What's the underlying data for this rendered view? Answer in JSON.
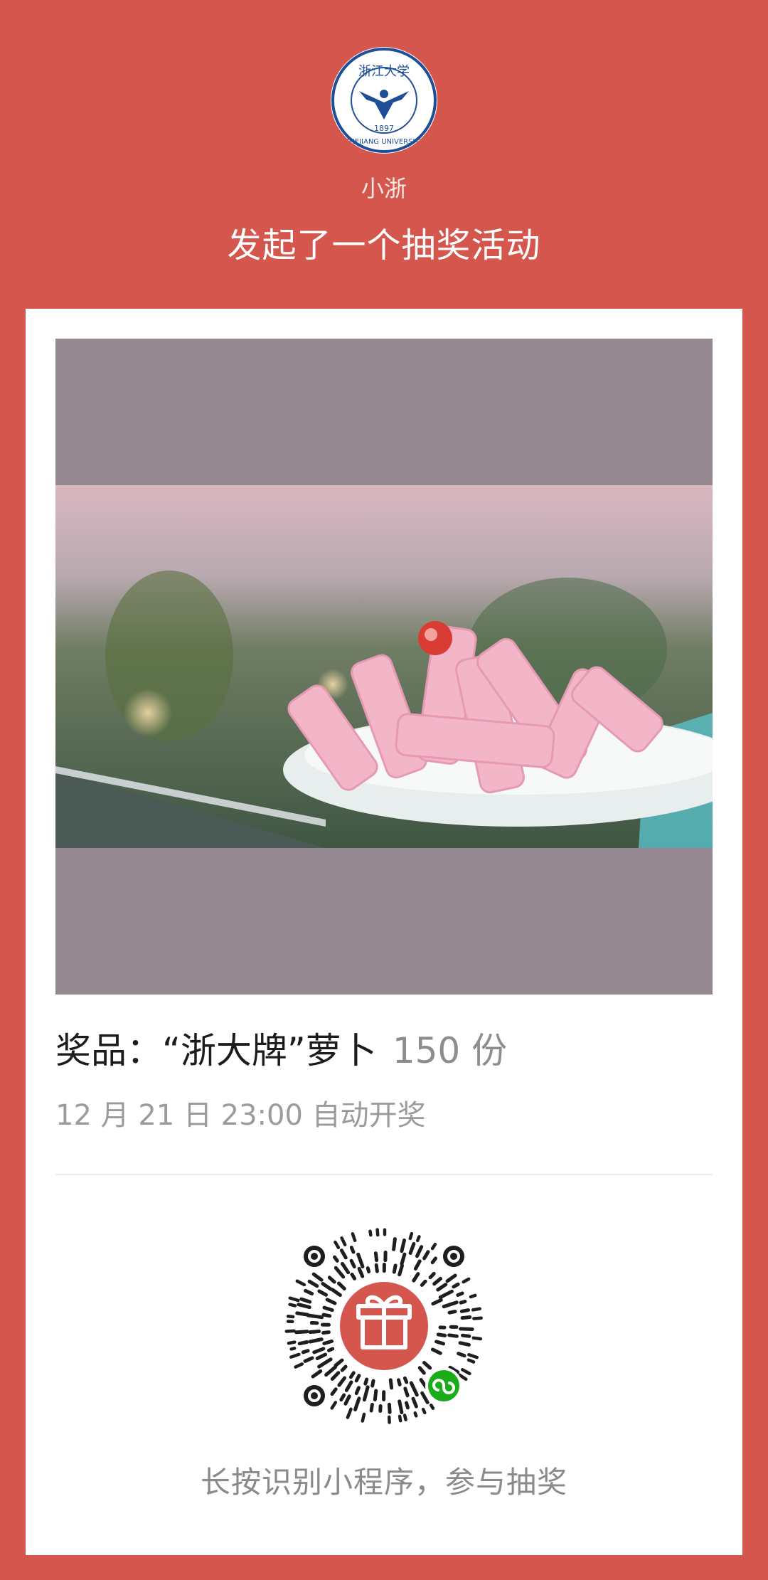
{
  "header": {
    "logo_text_top": "浙江大学",
    "logo_year": "1897",
    "logo_text_bottom": "ZHEJIANG UNIVERSITY",
    "nickname": "小浙",
    "headline": "发起了一个抽奖活动"
  },
  "prize": {
    "title": "奖品：“浙大牌”萝卜",
    "count": "150 份",
    "draw_time": "12 月 21 日 23:00 自动开奖"
  },
  "qr": {
    "center_icon": "gift-icon",
    "badge_icon": "mini-program-icon"
  },
  "footer": {
    "hint": "长按识别小程序，参与抽奖"
  },
  "colors": {
    "background": "#d5564c",
    "card": "#ffffff",
    "photo_frame": "#958890",
    "qr_center": "#d5564c",
    "badge": "#1aad19"
  }
}
